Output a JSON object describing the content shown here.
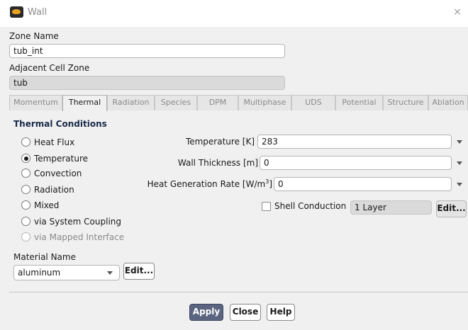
{
  "window": {
    "title": "Wall",
    "close_glyph": "×",
    "icon": "ansys-fluent-icon"
  },
  "zone": {
    "name_label": "Zone Name",
    "name_value": "tub_int"
  },
  "adjacent": {
    "label": "Adjacent Cell Zone",
    "value": "tub"
  },
  "tabs": [
    {
      "label": "Momentum",
      "active": false
    },
    {
      "label": "Thermal",
      "active": true
    },
    {
      "label": "Radiation",
      "active": false
    },
    {
      "label": "Species",
      "active": false
    },
    {
      "label": "DPM",
      "active": false
    },
    {
      "label": "Multiphase",
      "active": false
    },
    {
      "label": "UDS",
      "active": false
    },
    {
      "label": "Potential",
      "active": false
    },
    {
      "label": "Structure",
      "active": false
    },
    {
      "label": "Ablation",
      "active": false
    }
  ],
  "thermal": {
    "section_title": "Thermal Conditions",
    "options": [
      {
        "label": "Heat Flux",
        "checked": false,
        "disabled": false
      },
      {
        "label": "Temperature",
        "checked": true,
        "disabled": false
      },
      {
        "label": "Convection",
        "checked": false,
        "disabled": false
      },
      {
        "label": "Radiation",
        "checked": false,
        "disabled": false
      },
      {
        "label": "Mixed",
        "checked": false,
        "disabled": false
      },
      {
        "label": "via System Coupling",
        "checked": false,
        "disabled": false
      },
      {
        "label": "via Mapped Interface",
        "checked": false,
        "disabled": true
      }
    ],
    "temperature": {
      "label": "Temperature [K]",
      "value": "283"
    },
    "wall_thickness": {
      "label": "Wall Thickness [m]",
      "value": "0"
    },
    "heat_generation": {
      "label_prefix": "Heat Generation Rate [W/m",
      "label_sup": "3",
      "label_suffix": "]",
      "value": "0"
    },
    "shell_conduction": {
      "label": "Shell Conduction",
      "checked": false,
      "layers": "1 Layer",
      "edit_label": "Edit..."
    }
  },
  "material": {
    "label": "Material Name",
    "value": "aluminum",
    "edit_label": "Edit..."
  },
  "footer": {
    "apply_label": "Apply",
    "close_label": "Close",
    "help_label": "Help"
  },
  "colors": {
    "primary_button": "#5a6480",
    "section_title": "#1a2a4a"
  }
}
